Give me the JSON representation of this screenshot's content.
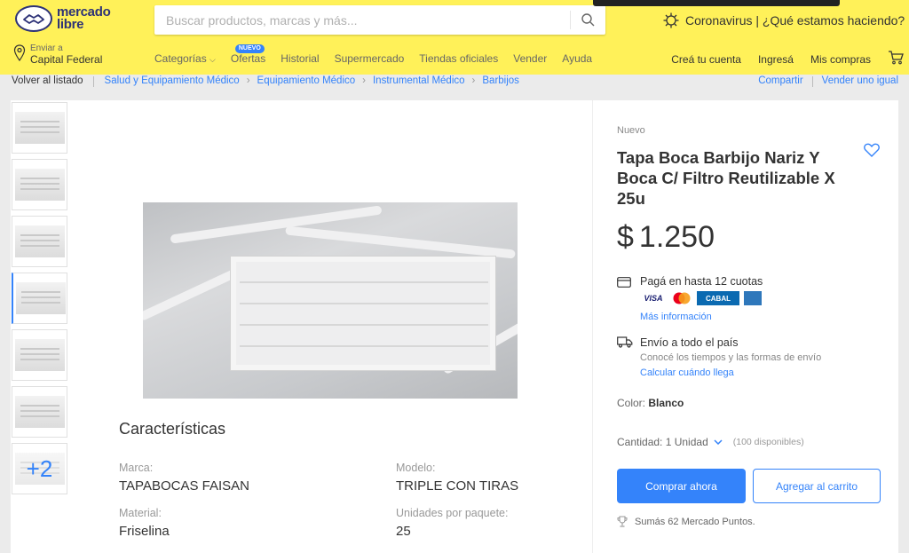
{
  "header": {
    "logo_line1": "mercado",
    "logo_line2": "libre",
    "search_placeholder": "Buscar productos, marcas y más...",
    "covid_text": "Coronavirus | ¿Qué estamos haciendo?",
    "location_small": "Enviar a",
    "location_big": "Capital Federal",
    "nav": [
      "Categorías",
      "Ofertas",
      "Historial",
      "Supermercado",
      "Tiendas oficiales",
      "Vender",
      "Ayuda"
    ],
    "new_badge": "NUEVO",
    "nav_right": [
      "Creá tu cuenta",
      "Ingresá",
      "Mis compras"
    ]
  },
  "breadcrumb": {
    "back": "Volver al listado",
    "items": [
      "Salud y Equipamiento Médico",
      "Equipamiento Médico",
      "Instrumental Médico",
      "Barbijos"
    ],
    "share": "Compartir",
    "sell": "Vender uno igual"
  },
  "gallery": {
    "more_label": "+2"
  },
  "characteristics": {
    "title": "Características",
    "attrs": [
      {
        "key": "Marca:",
        "value": "TAPABOCAS FAISAN"
      },
      {
        "key": "Modelo:",
        "value": "TRIPLE CON TIRAS"
      },
      {
        "key": "Material:",
        "value": "Friselina"
      },
      {
        "key": "Unidades por paquete:",
        "value": "25"
      }
    ]
  },
  "product": {
    "condition": "Nuevo",
    "title": "Tapa Boca Barbijo Nariz Y Boca C/ Filtro Reutilizable X 25u",
    "currency": "$",
    "price": "1.250",
    "pay_text": "Pagá en hasta 12 cuotas",
    "cards": [
      "VISA",
      "CABAL"
    ],
    "more_info": "Más información",
    "ship_text": "Envío a todo el país",
    "ship_sub": "Conocé los tiempos y las formas de envío",
    "ship_calc": "Calcular cuándo llega",
    "color_label": "Color:",
    "color_value": "Blanco",
    "qty_label": "Cantidad: 1 Unidad",
    "available": "(100 disponibles)",
    "buy_button": "Comprar ahora",
    "cart_button": "Agregar al carrito",
    "points": "Sumás 62 Mercado Puntos."
  },
  "colors": {
    "header_yellow": "#fff159",
    "brand_blue": "#3483fa",
    "logo_navy": "#2d3277"
  }
}
